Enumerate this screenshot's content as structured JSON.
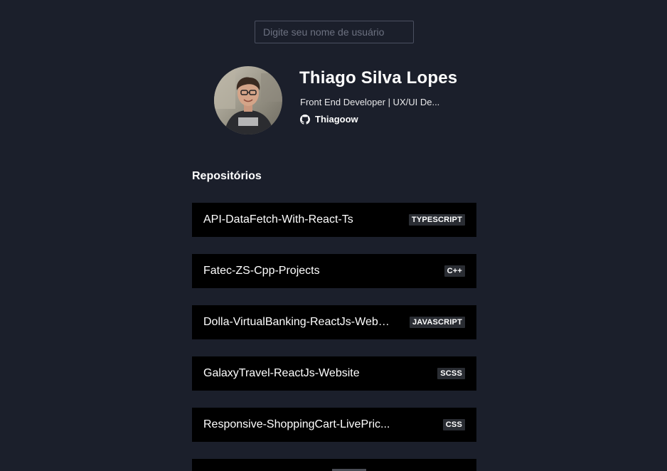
{
  "search": {
    "placeholder": "Digite seu nome de usuário",
    "value": ""
  },
  "profile": {
    "name": "Thiago Silva Lopes",
    "bio": "Front End Developer | UX/UI De...",
    "github_username": "Thiagoow",
    "github_icon": "github-icon"
  },
  "repositories": {
    "heading": "Repositórios",
    "items": [
      {
        "name": "API-DataFetch-With-React-Ts",
        "language": "TypeScript"
      },
      {
        "name": "Fatec-ZS-Cpp-Projects",
        "language": "C++"
      },
      {
        "name": "Dolla-VirtualBanking-ReactJs-Website",
        "language": "JavaScript"
      },
      {
        "name": "GalaxyTravel-ReactJs-Website",
        "language": "SCSS"
      },
      {
        "name": "Responsive-ShoppingCart-LivePric...",
        "language": "CSS"
      }
    ]
  },
  "colors": {
    "background": "#1b1f2b",
    "card": "#000000",
    "badge": "#2a2d33",
    "text": "#ffffff"
  }
}
